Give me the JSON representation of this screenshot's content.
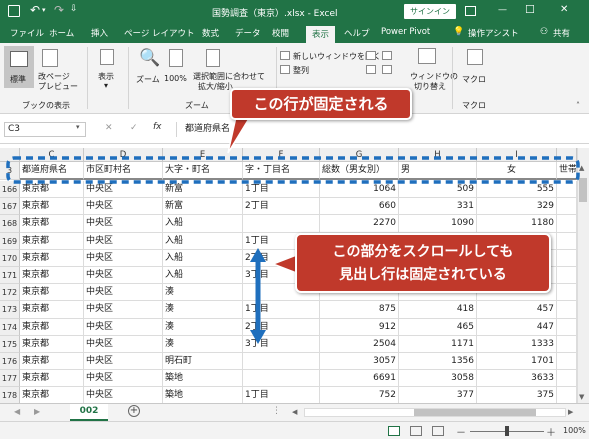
{
  "titlebar": {
    "title": "国勢調査（東京）.xlsx - Excel",
    "signin": "サインイン",
    "minimize": "—",
    "restore": "☐",
    "close": "✕"
  },
  "tabs": [
    "ファイル",
    "ホーム",
    "挿入",
    "ページ レイアウト",
    "数式",
    "データ",
    "校閲",
    "表示",
    "ヘルプ",
    "Power Pivot",
    "操作アシスト",
    "共有"
  ],
  "ribbon": {
    "normal": "標準",
    "page_break": "改ページ",
    "page_break2": "プレビュー",
    "views_group": "ブックの表示",
    "show": "表示",
    "zoom": "ズーム",
    "zoom100": "100%",
    "zoom_sel": "選択範囲に合わせて",
    "zoom_sel2": "拡大/縮小",
    "zoom_group": "ズーム",
    "new_window": "新しいウィンドウを開く",
    "arrange": "整列",
    "switch": "ウィンドウの",
    "switch2": "切り替え",
    "macro": "マクロ",
    "macro_group": "マクロ"
  },
  "formula": {
    "namebox": "C3",
    "cancel": "✕",
    "enter": "✓",
    "fx": "fx",
    "value": "都道府県名"
  },
  "columns": [
    "C",
    "D",
    "E",
    "F",
    "G",
    "H",
    "I"
  ],
  "header_row": {
    "num": "3",
    "cells": [
      "都道府県名",
      "市区町村名",
      "大字・町名",
      "字・丁目名",
      "総数（男女別）",
      "男",
      "女",
      "世帯"
    ]
  },
  "rows": [
    {
      "num": "166",
      "c": "東京都",
      "d": "中央区",
      "e": "新富",
      "f": "1丁目",
      "g": "1064",
      "h": "509",
      "i": "555"
    },
    {
      "num": "167",
      "c": "東京都",
      "d": "中央区",
      "e": "新富",
      "f": "2丁目",
      "g": "660",
      "h": "331",
      "i": "329"
    },
    {
      "num": "168",
      "c": "東京都",
      "d": "中央区",
      "e": "入船",
      "f": "",
      "g": "2270",
      "h": "1090",
      "i": "1180"
    },
    {
      "num": "169",
      "c": "東京都",
      "d": "中央区",
      "e": "入船",
      "f": "1丁目",
      "g": "",
      "h": "",
      "i": ""
    },
    {
      "num": "170",
      "c": "東京都",
      "d": "中央区",
      "e": "入船",
      "f": "2丁目",
      "g": "",
      "h": "",
      "i": ""
    },
    {
      "num": "171",
      "c": "東京都",
      "d": "中央区",
      "e": "入船",
      "f": "3丁目",
      "g": "",
      "h": "",
      "i": ""
    },
    {
      "num": "172",
      "c": "東京都",
      "d": "中央区",
      "e": "湊",
      "f": "",
      "g": "",
      "h": "",
      "i": ""
    },
    {
      "num": "173",
      "c": "東京都",
      "d": "中央区",
      "e": "湊",
      "f": "1丁目",
      "g": "875",
      "h": "418",
      "i": "457"
    },
    {
      "num": "174",
      "c": "東京都",
      "d": "中央区",
      "e": "湊",
      "f": "2丁目",
      "g": "912",
      "h": "465",
      "i": "447"
    },
    {
      "num": "175",
      "c": "東京都",
      "d": "中央区",
      "e": "湊",
      "f": "3丁目",
      "g": "2504",
      "h": "1171",
      "i": "1333"
    },
    {
      "num": "176",
      "c": "東京都",
      "d": "中央区",
      "e": "明石町",
      "f": "",
      "g": "3057",
      "h": "1356",
      "i": "1701"
    },
    {
      "num": "177",
      "c": "東京都",
      "d": "中央区",
      "e": "築地",
      "f": "",
      "g": "6691",
      "h": "3058",
      "i": "3633"
    },
    {
      "num": "178",
      "c": "東京都",
      "d": "中央区",
      "e": "築地",
      "f": "1丁目",
      "g": "752",
      "h": "377",
      "i": "375"
    }
  ],
  "sheet": {
    "name": "002"
  },
  "status": {
    "zoom": "100%",
    "minus": "－",
    "plus": "＋"
  },
  "callouts": {
    "frozen": "この行が固定される",
    "scroll1": "この部分をスクロールしても",
    "scroll2": "見出し行は固定されている"
  },
  "colors": {
    "excel_green": "#217346",
    "callout_red": "#c0392b",
    "dash_blue": "#1f6fbd"
  }
}
